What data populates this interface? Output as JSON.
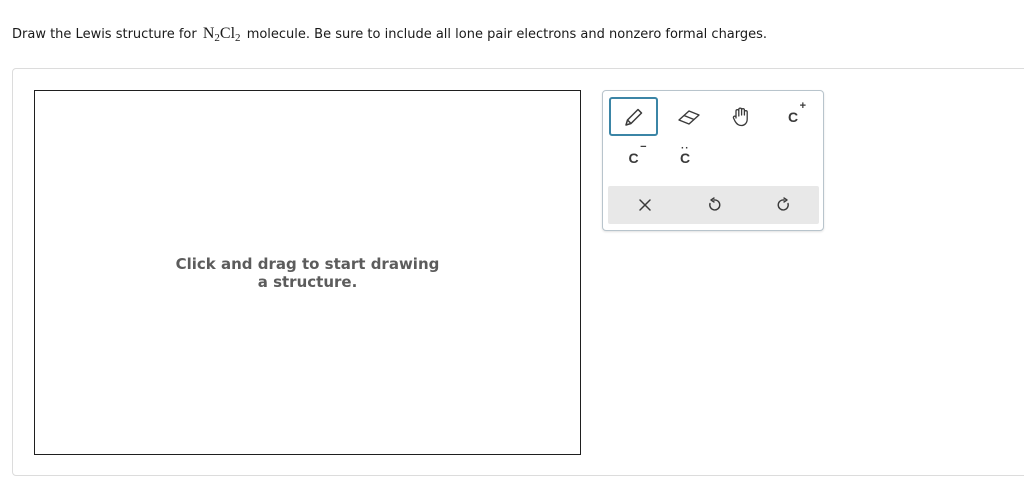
{
  "question": {
    "prefix": "Draw the Lewis structure for",
    "formula": {
      "el1": "N",
      "sub1": "2",
      "el2": "Cl",
      "sub2": "2"
    },
    "suffix": "molecule. Be sure to include all lone pair electrons and nonzero formal charges."
  },
  "canvas": {
    "placeholder": "Click and drag to start drawing a structure."
  },
  "toolbar": {
    "tools": [
      {
        "name": "pencil",
        "icon": "pencil-icon",
        "selected": true
      },
      {
        "name": "eraser",
        "icon": "eraser-icon"
      },
      {
        "name": "hand",
        "icon": "hand-icon"
      },
      {
        "name": "positive-charge",
        "label": "C",
        "mark": "+"
      },
      {
        "name": "negative-charge",
        "label": "C",
        "mark": "−"
      },
      {
        "name": "lone-pair",
        "label": "C",
        "mark": ":"
      }
    ],
    "actions": [
      {
        "name": "clear",
        "icon": "close-icon"
      },
      {
        "name": "undo",
        "icon": "undo-icon"
      },
      {
        "name": "redo",
        "icon": "redo-icon"
      }
    ]
  },
  "colors": {
    "selected_border": "#3b85a6",
    "action_bar": "#e8e8e8",
    "placeholder_text": "#5c5c5c"
  }
}
